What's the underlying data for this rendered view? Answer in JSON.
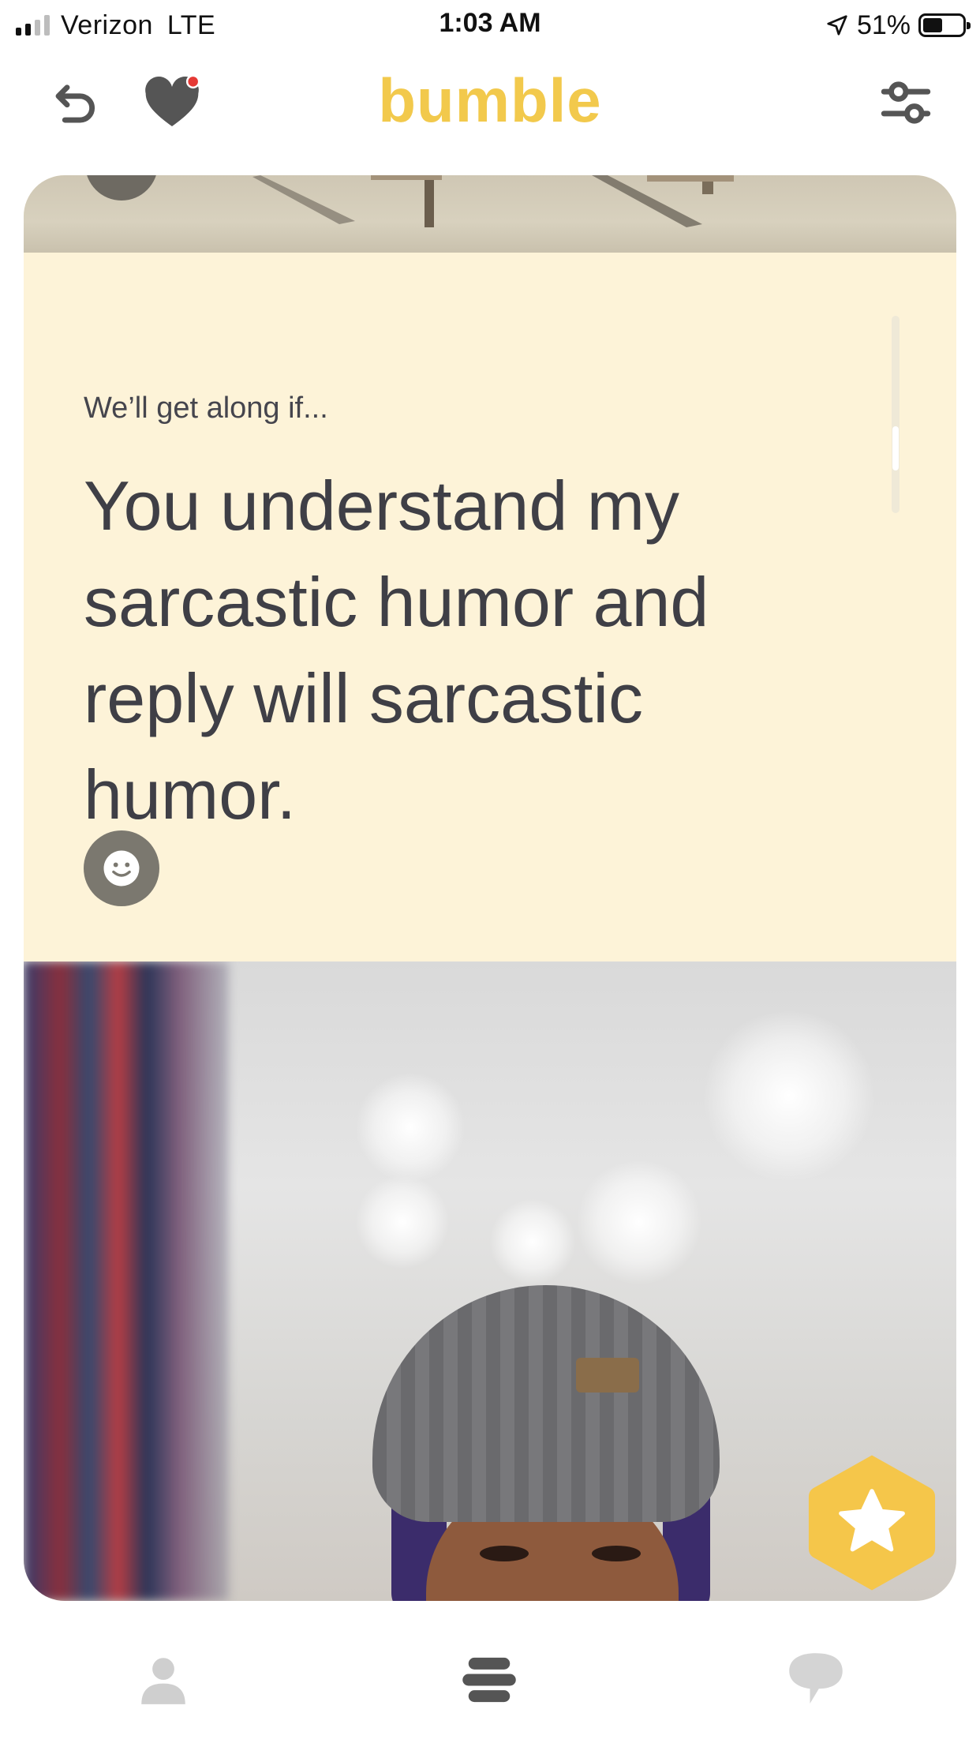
{
  "status_bar": {
    "carrier": "Verizon",
    "network": "LTE",
    "time": "1:03 AM",
    "battery_pct": "51%",
    "battery_level": 0.51,
    "signal_bars_active": 2
  },
  "nav": {
    "logo": "bumble",
    "left_icons": [
      "undo-icon",
      "liked-you-icon"
    ],
    "right_icon": "filters-icon",
    "notification_dot_color": "#e53935",
    "brand_color": "#f2c94c"
  },
  "card": {
    "prompt_label": "We’ll get along if...",
    "prompt_answer": "You understand my sarcastic humor and reply will sarcastic humor.",
    "react_icon": "smiley-icon",
    "superswipe_icon": "star-icon",
    "background_color": "#fdf3d8"
  },
  "tabbar": {
    "tabs": [
      {
        "name": "profile",
        "icon": "person-icon",
        "active": false
      },
      {
        "name": "discover",
        "icon": "stack-icon",
        "active": true
      },
      {
        "name": "chats",
        "icon": "chat-bubble-icon",
        "active": false
      }
    ]
  }
}
